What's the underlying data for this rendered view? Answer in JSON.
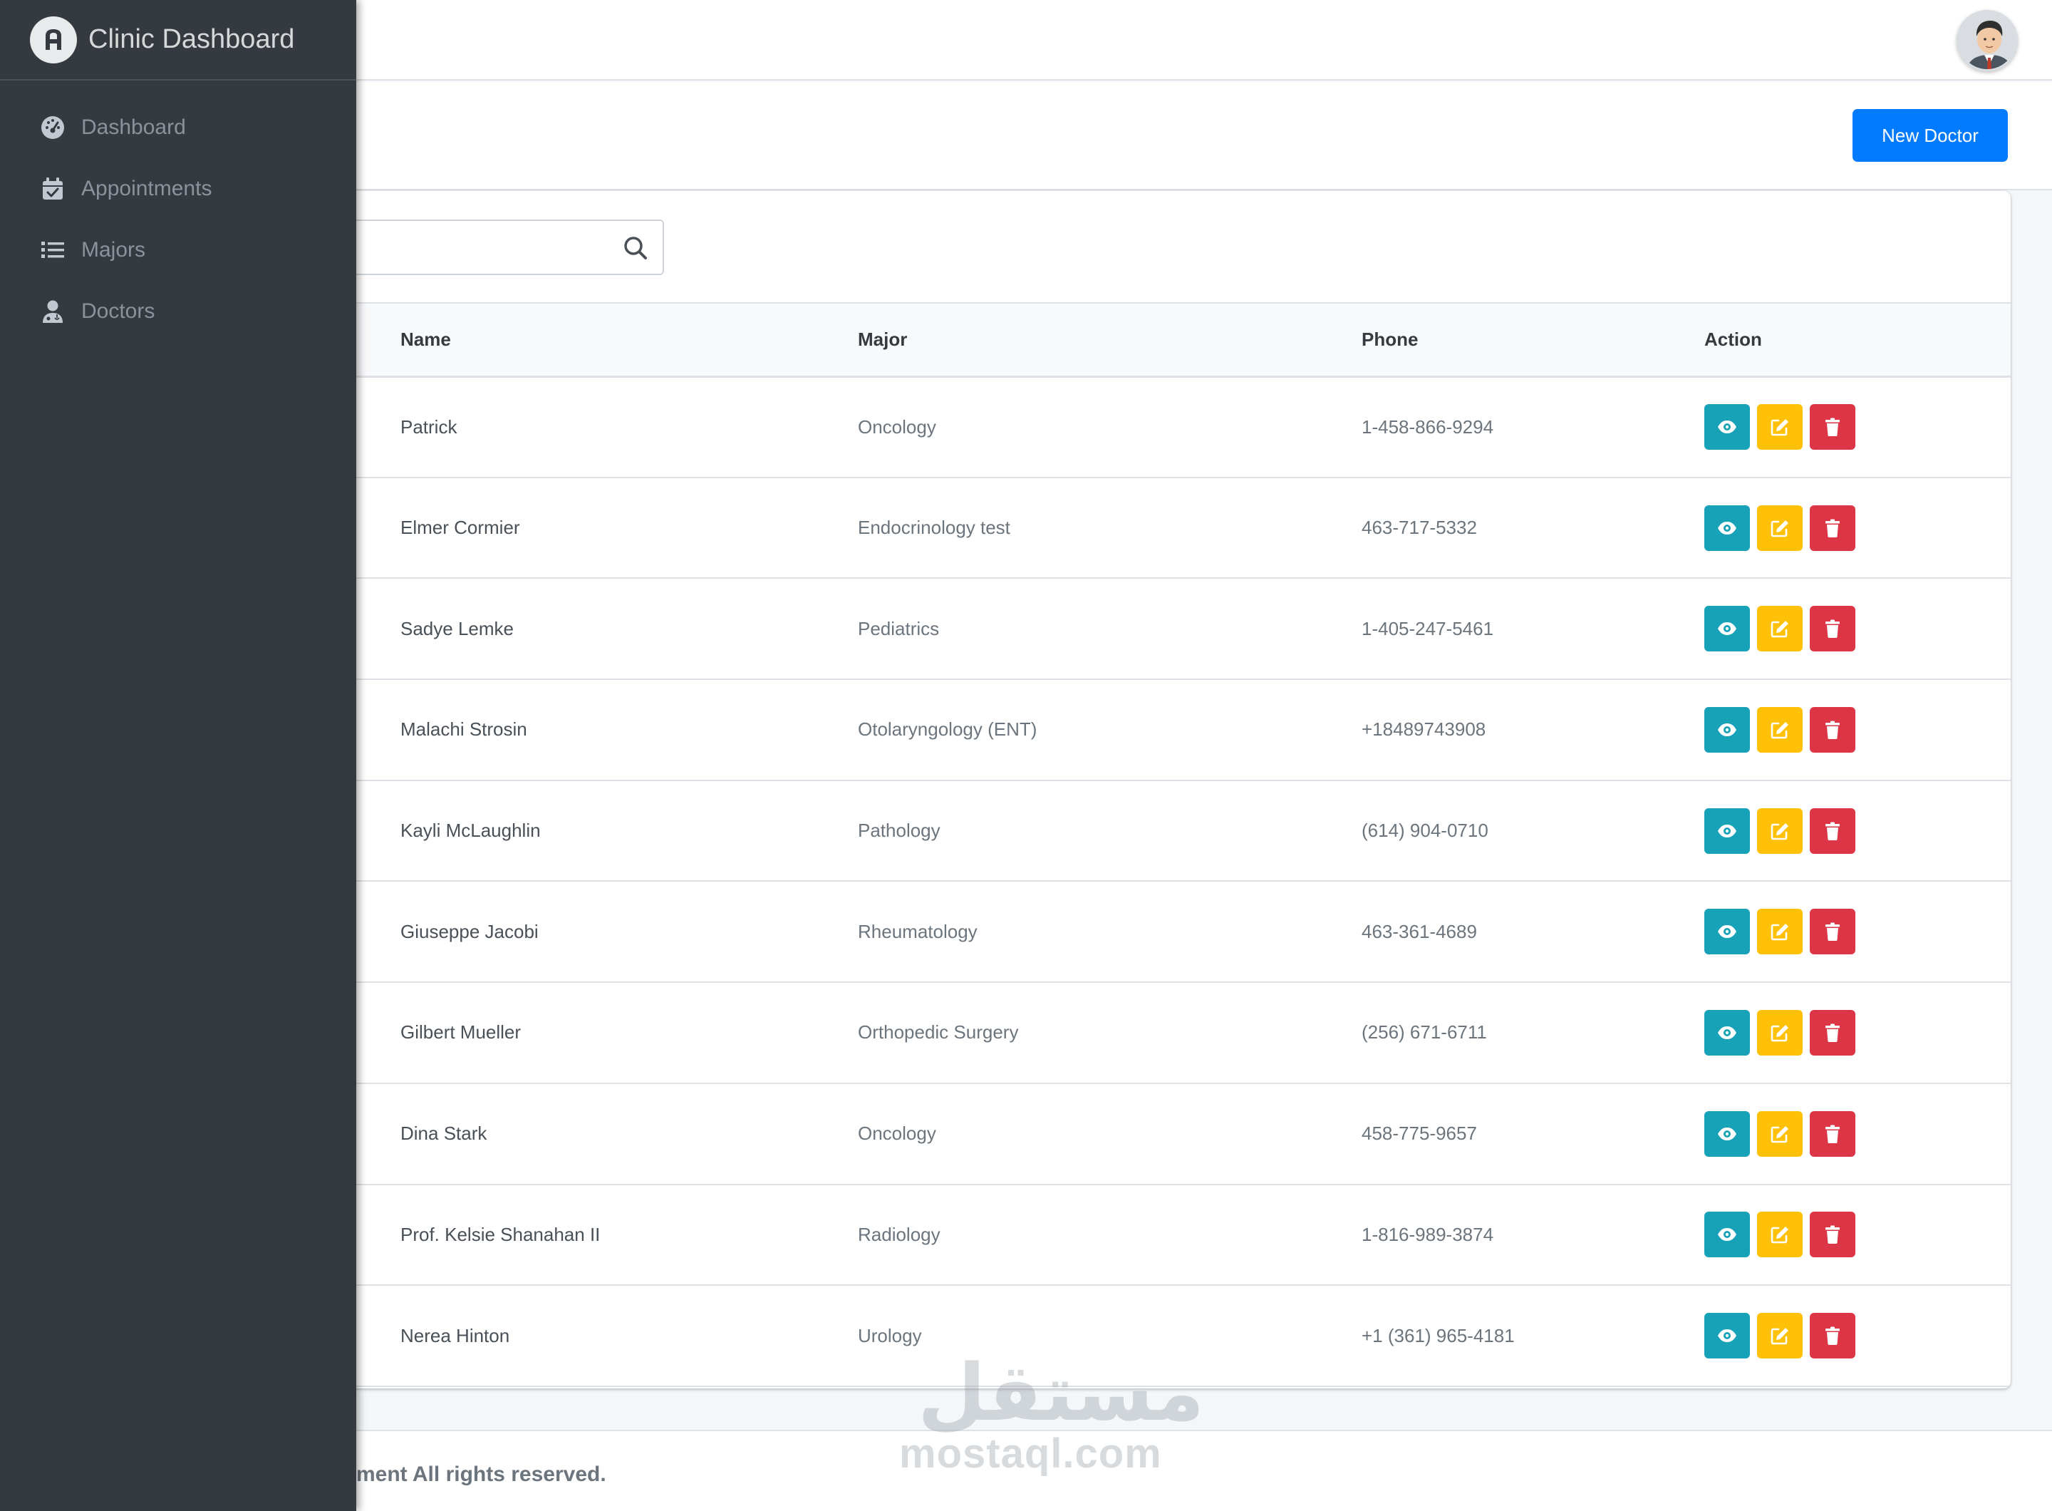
{
  "brand": {
    "title": "Clinic Dashboard"
  },
  "sidebar": {
    "items": [
      {
        "label": "Dashboard",
        "icon": "tachometer-icon"
      },
      {
        "label": "Appointments",
        "icon": "calendar-check-icon"
      },
      {
        "label": "Majors",
        "icon": "list-icon"
      },
      {
        "label": "Doctors",
        "icon": "user-doctor-icon"
      }
    ]
  },
  "header": {
    "new_button_label": "New Doctor",
    "avatar_icon": "user-avatar"
  },
  "search": {
    "value": "",
    "placeholder": ""
  },
  "table": {
    "columns": [
      "Name",
      "Major",
      "Phone",
      "Action"
    ],
    "rows": [
      {
        "name": "Patrick",
        "major": "Oncology",
        "phone": "1-458-866-9294"
      },
      {
        "name": "Elmer Cormier",
        "major": "Endocrinology test",
        "phone": "463-717-5332"
      },
      {
        "name": "Sadye Lemke",
        "major": "Pediatrics",
        "phone": "1-405-247-5461"
      },
      {
        "name": "Malachi Strosin",
        "major": "Otolaryngology (ENT)",
        "phone": "+18489743908"
      },
      {
        "name": "Kayli McLaughlin",
        "major": "Pathology",
        "phone": "(614) 904-0710"
      },
      {
        "name": "Giuseppe Jacobi",
        "major": "Rheumatology",
        "phone": "463-361-4689"
      },
      {
        "name": "Gilbert Mueller",
        "major": "Orthopedic Surgery",
        "phone": "(256) 671-6711"
      },
      {
        "name": "Dina Stark",
        "major": "Oncology",
        "phone": "458-775-9657"
      },
      {
        "name": "Prof. Kelsie Shanahan II",
        "major": "Radiology",
        "phone": "1-816-989-3874"
      },
      {
        "name": "Nerea Hinton",
        "major": "Urology",
        "phone": "+1 (361) 965-4181"
      }
    ],
    "action_icons": [
      "eye-icon",
      "edit-icon",
      "trash-icon"
    ]
  },
  "footer": {
    "text": "ment All rights reserved."
  },
  "watermark": {
    "latin": "mostaql.com",
    "arabic": "مستقل"
  },
  "colors": {
    "primary": "#007bff",
    "info": "#17a2b8",
    "warning": "#ffc107",
    "danger": "#dc3545",
    "sidebar": "#343a40"
  }
}
